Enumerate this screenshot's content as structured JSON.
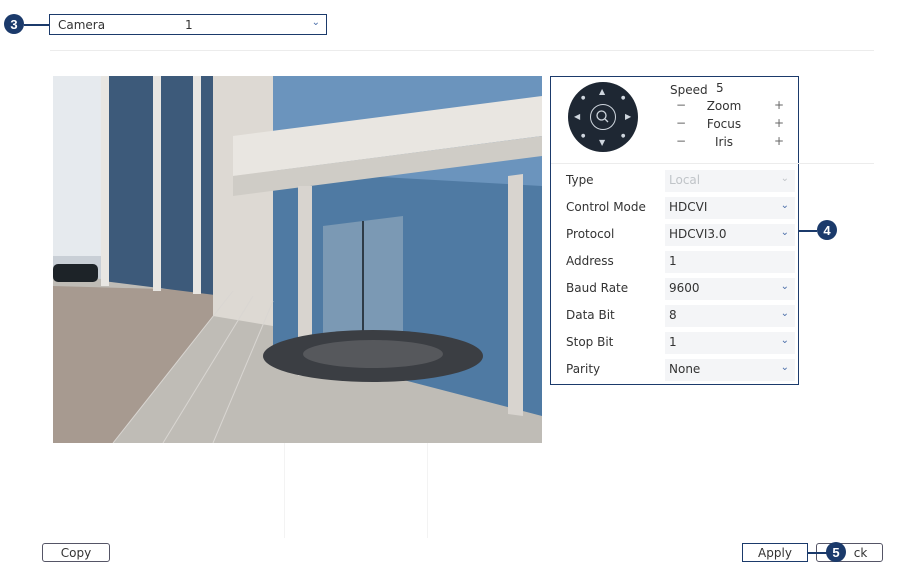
{
  "camera": {
    "label": "Camera",
    "value": "1"
  },
  "ptz": {
    "speed_label": "Speed",
    "speed_value": "5",
    "zoom_label": "Zoom",
    "focus_label": "Focus",
    "iris_label": "Iris",
    "minus": "−",
    "plus": "+"
  },
  "settings": [
    {
      "key": "Type",
      "value": "Local",
      "dropdown": true,
      "disabled": true
    },
    {
      "key": "Control Mode",
      "value": "HDCVI",
      "dropdown": true
    },
    {
      "key": "Protocol",
      "value": "HDCVI3.0",
      "dropdown": true
    },
    {
      "key": "Address",
      "value": "1",
      "dropdown": false
    },
    {
      "key": "Baud Rate",
      "value": "9600",
      "dropdown": true
    },
    {
      "key": "Data Bit",
      "value": "8",
      "dropdown": true
    },
    {
      "key": "Stop Bit",
      "value": "1",
      "dropdown": true
    },
    {
      "key": "Parity",
      "value": "None",
      "dropdown": true
    }
  ],
  "buttons": {
    "copy": "Copy",
    "apply": "Apply",
    "back": "Back",
    "back_visible": "ck"
  },
  "callouts": {
    "camera": "3",
    "settings": "4",
    "apply": "5"
  },
  "colors": {
    "accent": "#1b3a6b",
    "chevron": "#4a6ea9"
  }
}
